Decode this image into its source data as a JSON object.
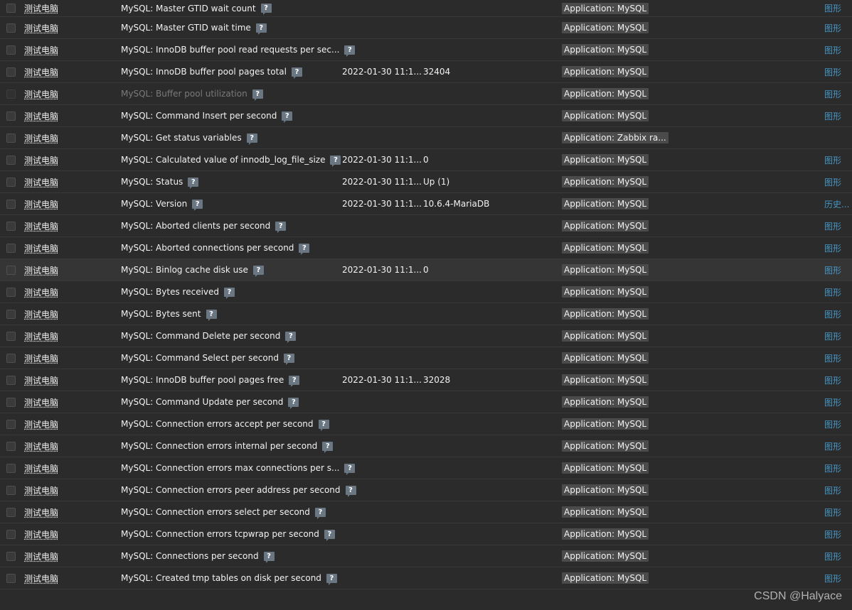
{
  "help_glyph": "?",
  "icons": {
    "help": "comment-help-icon"
  },
  "colors": {
    "link": "#4796c4",
    "tag_bg": "#4b4b4b",
    "help_bg": "#6a7783"
  },
  "watermark": "CSDN @Halyace",
  "rows": [
    {
      "host": "测试电脑",
      "name": "MySQL: Master GTID wait count",
      "time": "",
      "value": "",
      "tag": "Application: MySQL",
      "link": "图形"
    },
    {
      "host": "测试电脑",
      "name": "MySQL: Master GTID wait time",
      "time": "",
      "value": "",
      "tag": "Application: MySQL",
      "link": "图形"
    },
    {
      "host": "测试电脑",
      "name": "MySQL: InnoDB buffer pool read requests per sec...",
      "time": "",
      "value": "",
      "tag": "Application: MySQL",
      "link": "图形"
    },
    {
      "host": "测试电脑",
      "name": "MySQL: InnoDB buffer pool pages total",
      "time": "2022-01-30 11:1...",
      "value": "32404",
      "tag": "Application: MySQL",
      "link": "图形"
    },
    {
      "host": "测试电脑",
      "name": "MySQL: Buffer pool utilization",
      "time": "",
      "value": "",
      "tag": "Application: MySQL",
      "link": "图形",
      "disabled": true
    },
    {
      "host": "测试电脑",
      "name": "MySQL: Command Insert per second",
      "time": "",
      "value": "",
      "tag": "Application: MySQL",
      "link": "图形"
    },
    {
      "host": "测试电脑",
      "name": "MySQL: Get status variables",
      "time": "",
      "value": "",
      "tag": "Application: Zabbix ra...",
      "link": ""
    },
    {
      "host": "测试电脑",
      "name": "MySQL: Calculated value of innodb_log_file_size",
      "time": "2022-01-30 11:1...",
      "value": "0",
      "tag": "Application: MySQL",
      "link": "图形"
    },
    {
      "host": "测试电脑",
      "name": "MySQL: Status",
      "time": "2022-01-30 11:1...",
      "value": "Up (1)",
      "tag": "Application: MySQL",
      "link": "图形"
    },
    {
      "host": "测试电脑",
      "name": "MySQL: Version",
      "time": "2022-01-30 11:1...",
      "value": "10.6.4-MariaDB",
      "tag": "Application: MySQL",
      "link": "历史..."
    },
    {
      "host": "测试电脑",
      "name": "MySQL: Aborted clients per second",
      "time": "",
      "value": "",
      "tag": "Application: MySQL",
      "link": "图形"
    },
    {
      "host": "测试电脑",
      "name": "MySQL: Aborted connections per second",
      "time": "",
      "value": "",
      "tag": "Application: MySQL",
      "link": "图形"
    },
    {
      "host": "测试电脑",
      "name": "MySQL: Binlog cache disk use",
      "time": "2022-01-30 11:1...",
      "value": "0",
      "tag": "Application: MySQL",
      "link": "图形",
      "hover": true
    },
    {
      "host": "测试电脑",
      "name": "MySQL: Bytes received",
      "time": "",
      "value": "",
      "tag": "Application: MySQL",
      "link": "图形"
    },
    {
      "host": "测试电脑",
      "name": "MySQL: Bytes sent",
      "time": "",
      "value": "",
      "tag": "Application: MySQL",
      "link": "图形"
    },
    {
      "host": "测试电脑",
      "name": "MySQL: Command Delete per second",
      "time": "",
      "value": "",
      "tag": "Application: MySQL",
      "link": "图形"
    },
    {
      "host": "测试电脑",
      "name": "MySQL: Command Select per second",
      "time": "",
      "value": "",
      "tag": "Application: MySQL",
      "link": "图形"
    },
    {
      "host": "测试电脑",
      "name": "MySQL: InnoDB buffer pool pages free",
      "time": "2022-01-30 11:1...",
      "value": "32028",
      "tag": "Application: MySQL",
      "link": "图形"
    },
    {
      "host": "测试电脑",
      "name": "MySQL: Command Update per second",
      "time": "",
      "value": "",
      "tag": "Application: MySQL",
      "link": "图形"
    },
    {
      "host": "测试电脑",
      "name": "MySQL: Connection errors accept per second",
      "time": "",
      "value": "",
      "tag": "Application: MySQL",
      "link": "图形"
    },
    {
      "host": "测试电脑",
      "name": "MySQL: Connection errors internal per second",
      "time": "",
      "value": "",
      "tag": "Application: MySQL",
      "link": "图形"
    },
    {
      "host": "测试电脑",
      "name": "MySQL: Connection errors max connections per s...",
      "time": "",
      "value": "",
      "tag": "Application: MySQL",
      "link": "图形"
    },
    {
      "host": "测试电脑",
      "name": "MySQL: Connection errors peer address per second",
      "time": "",
      "value": "",
      "tag": "Application: MySQL",
      "link": "图形"
    },
    {
      "host": "测试电脑",
      "name": "MySQL: Connection errors select per second",
      "time": "",
      "value": "",
      "tag": "Application: MySQL",
      "link": "图形"
    },
    {
      "host": "测试电脑",
      "name": "MySQL: Connection errors tcpwrap per second",
      "time": "",
      "value": "",
      "tag": "Application: MySQL",
      "link": "图形"
    },
    {
      "host": "测试电脑",
      "name": "MySQL: Connections per second",
      "time": "",
      "value": "",
      "tag": "Application: MySQL",
      "link": "图形"
    },
    {
      "host": "测试电脑",
      "name": "MySQL: Created tmp tables on disk per second",
      "time": "",
      "value": "",
      "tag": "Application: MySQL",
      "link": "图形"
    }
  ]
}
